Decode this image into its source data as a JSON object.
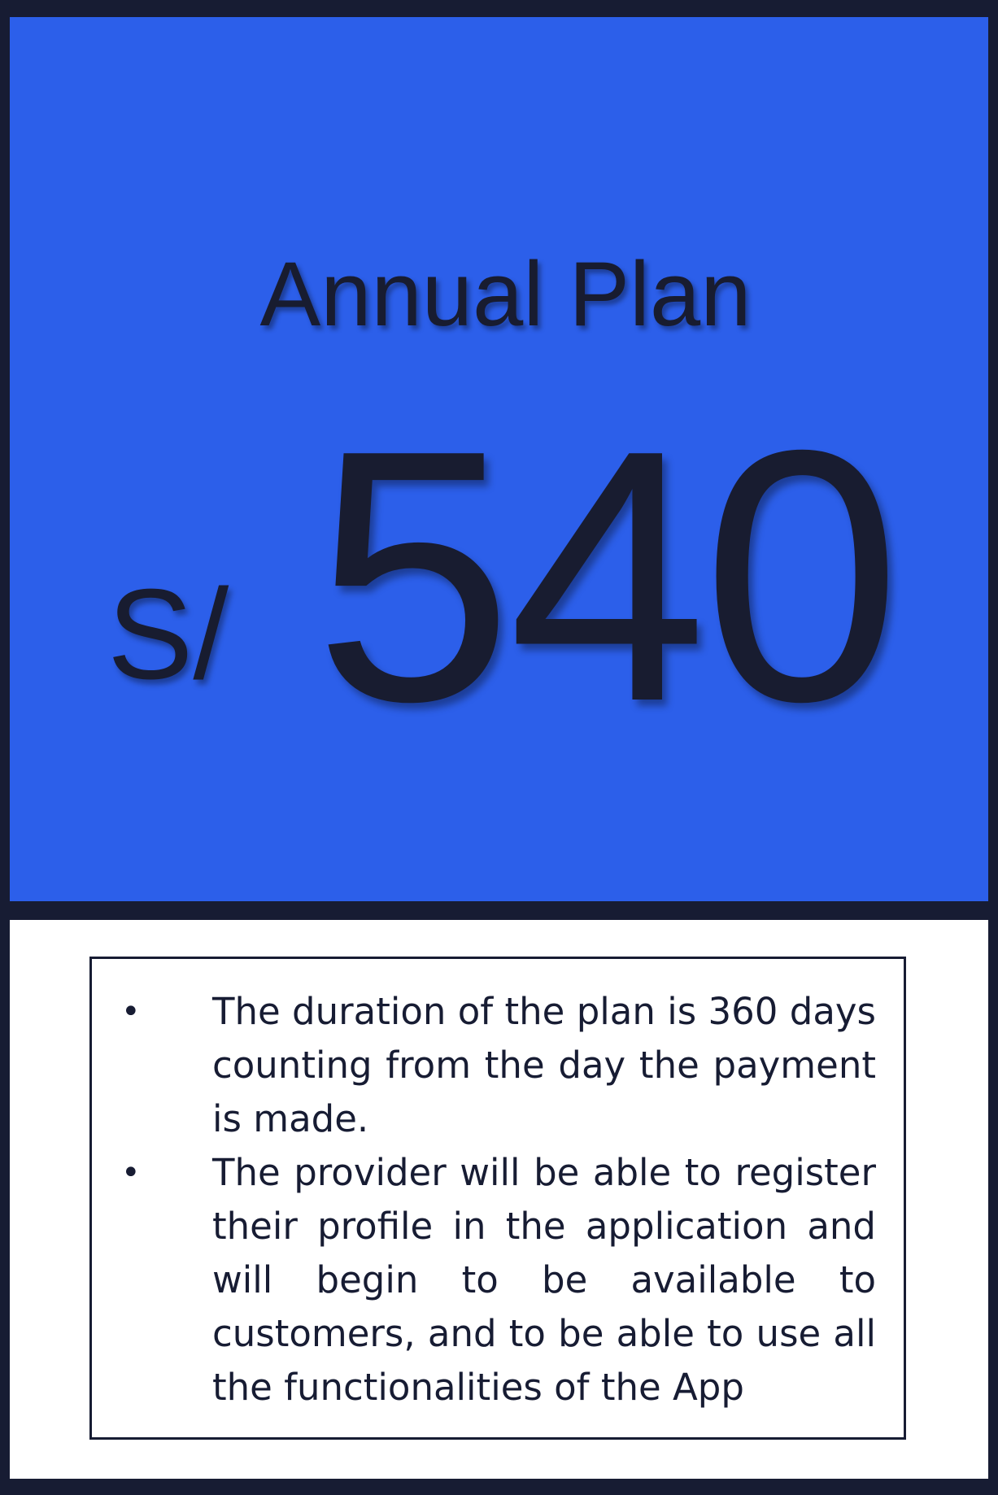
{
  "plan": {
    "title": "Annual Plan",
    "currency": "S/",
    "price": "540"
  },
  "features": [
    {
      "bullet": "•",
      "text": "The duration of the plan is 360 days counting from the day the payment is made."
    },
    {
      "bullet": "•",
      "text": "The provider will be able to register their profile in the application and will begin to be available to customers, and to be able to use all the functionalities of the App"
    }
  ],
  "colors": {
    "frame": "#171c33",
    "header_background": "#2c5fea",
    "body_background": "#ffffff",
    "text": "#181c30"
  }
}
